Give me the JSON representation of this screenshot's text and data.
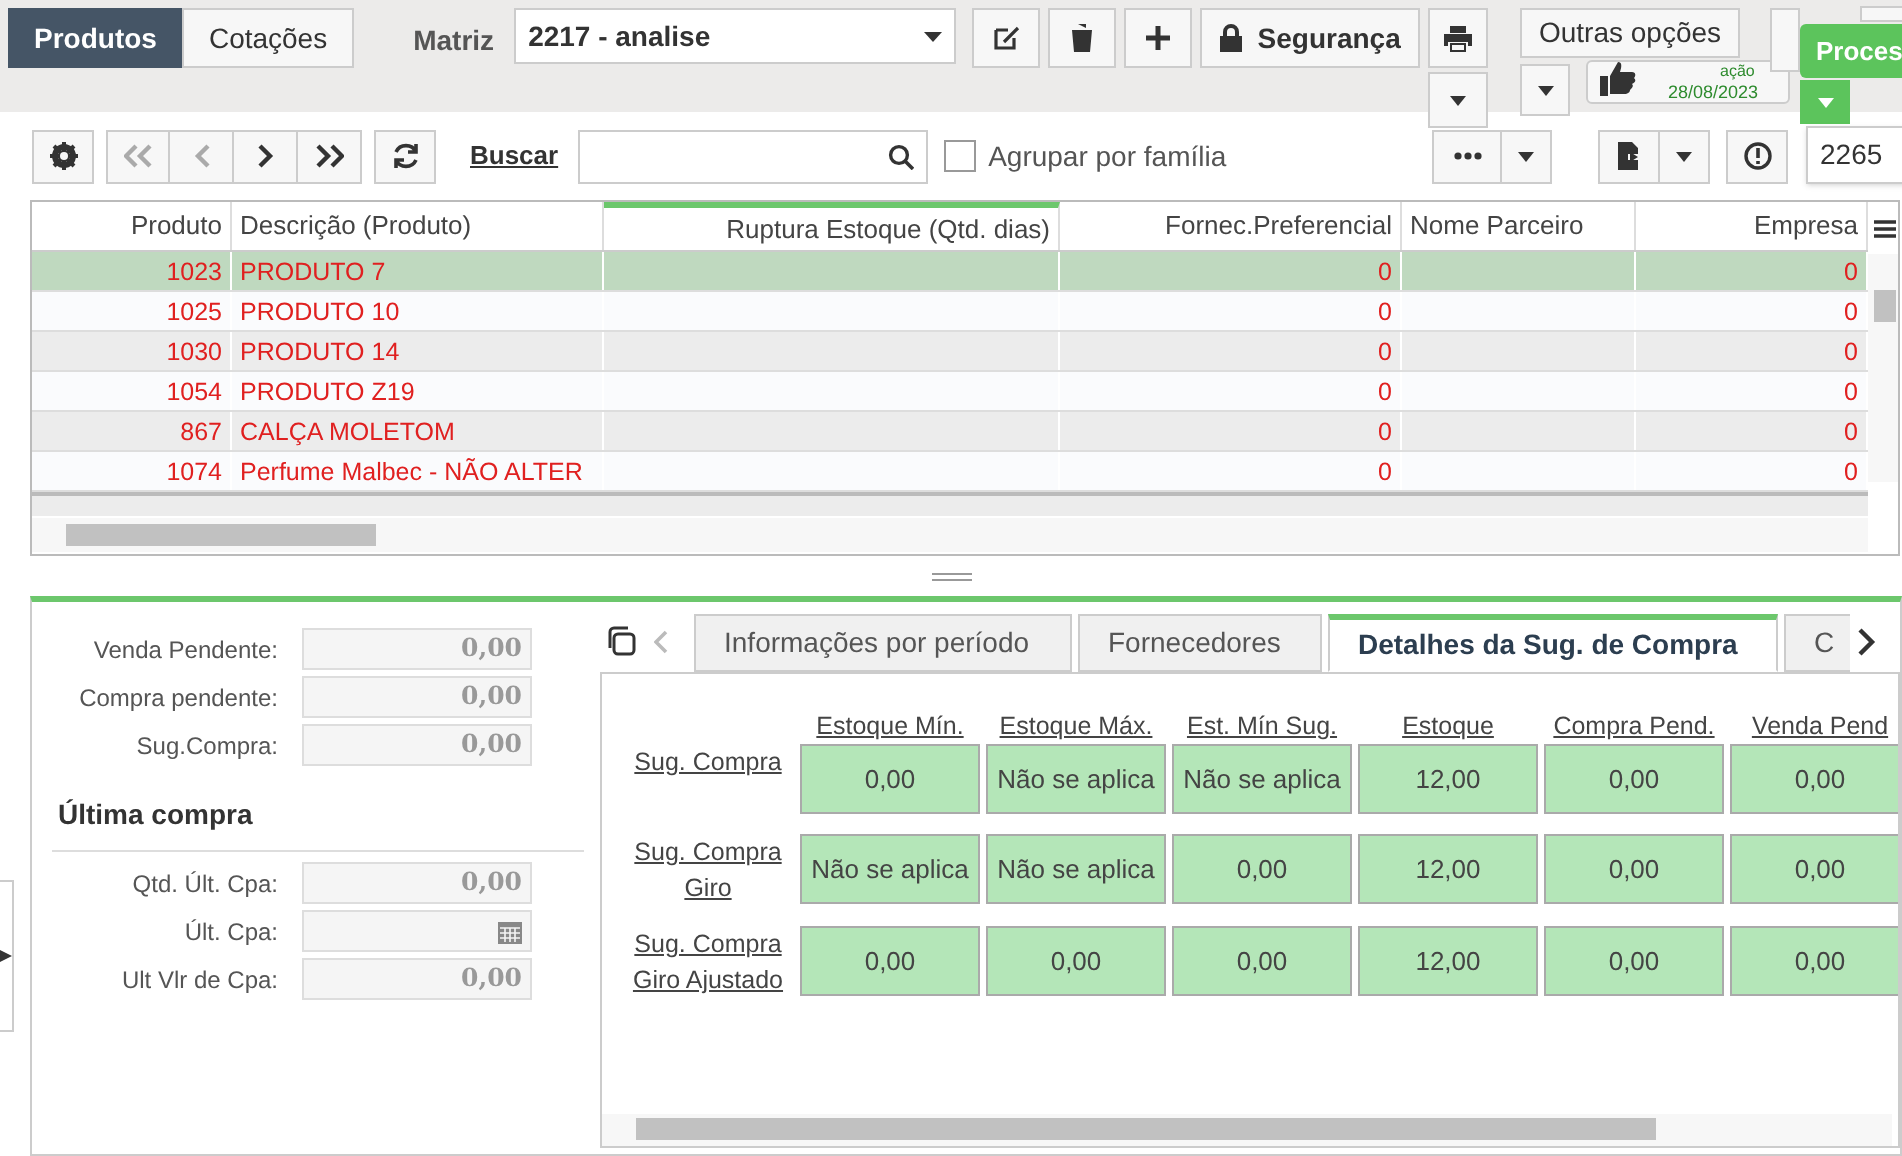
{
  "top_tabs": [
    {
      "label": "Produtos",
      "selected": true
    },
    {
      "label": "Cotações",
      "selected": false
    }
  ],
  "matriz": {
    "label": "Matriz",
    "value": "2217 - analise"
  },
  "security_button": "Segurança",
  "other_options": "Outras opções",
  "notification": {
    "text": "ação",
    "date": "28/08/2023"
  },
  "process_button": "Proces",
  "tooltip": "2265",
  "toolbar": {
    "first_disabled": true,
    "prev_disabled": true,
    "search_link": "Buscar",
    "group_checkbox": {
      "label": "Agrupar por família",
      "checked": false
    }
  },
  "table": {
    "columns": [
      "Produto",
      "Descrição (Produto)",
      "Ruptura Estoque (Qtd. dias)",
      "Fornec.Preferencial",
      "Nome Parceiro",
      "Empresa"
    ],
    "rows": [
      {
        "cells": [
          "1023",
          "PRODUTO 7",
          "",
          "0",
          "",
          "0"
        ],
        "selected": true
      },
      {
        "cells": [
          "1025",
          "PRODUTO 10",
          "",
          "0",
          "",
          "0"
        ],
        "selected": false
      },
      {
        "cells": [
          "1030",
          "PRODUTO 14",
          "",
          "0",
          "",
          "0"
        ],
        "selected": false
      },
      {
        "cells": [
          "1054",
          "PRODUTO Z19",
          "",
          "0",
          "",
          "0"
        ],
        "selected": false
      },
      {
        "cells": [
          "867",
          "CALÇA MOLETOM",
          "",
          "0",
          "",
          "0"
        ],
        "selected": false
      },
      {
        "cells": [
          "1074",
          "Perfume Malbec - NÃO ALTER",
          "",
          "0",
          "",
          "0"
        ],
        "selected": false
      }
    ]
  },
  "fields": [
    {
      "label": "Venda Pendente:",
      "value": "0,00",
      "kind": "number"
    },
    {
      "label": "Compra pendente:",
      "value": "0,00",
      "kind": "number"
    },
    {
      "label": "Sug.Compra:",
      "value": "0,00",
      "kind": "number"
    }
  ],
  "last_purchase": {
    "title": "Última compra",
    "fields": [
      {
        "label": "Qtd. Últ. Cpa:",
        "value": "0,00",
        "kind": "number"
      },
      {
        "label": "Últ. Cpa:",
        "kind": "date"
      },
      {
        "label": "Ult Vlr de Cpa:",
        "value": "0,00",
        "kind": "number"
      }
    ]
  },
  "detail_tabs": [
    {
      "label": "Informações por período",
      "selected": false
    },
    {
      "label": "Fornecedores",
      "selected": false
    },
    {
      "label": "Detalhes da Sug. de Compra",
      "selected": true
    },
    {
      "label": "C",
      "selected": false
    }
  ],
  "matrix": {
    "columns": [
      "Estoque Mín.",
      "Estoque Máx.",
      "Est. Mín Sug.",
      "Estoque",
      "Compra Pend.",
      "Venda Pend"
    ],
    "rows": [
      {
        "label": "Sug. Compra",
        "values": [
          "0,00",
          "Não se aplica",
          "Não se aplica",
          "12,00",
          "0,00",
          "0,00"
        ]
      },
      {
        "label": "Sug. Compra Giro",
        "values": [
          "Não se aplica",
          "Não se aplica",
          "0,00",
          "12,00",
          "0,00",
          "0,00"
        ]
      },
      {
        "label": "Sug. Compra Giro Ajustado",
        "values": [
          "0,00",
          "0,00",
          "0,00",
          "12,00",
          "0,00",
          "0,00"
        ]
      }
    ]
  }
}
